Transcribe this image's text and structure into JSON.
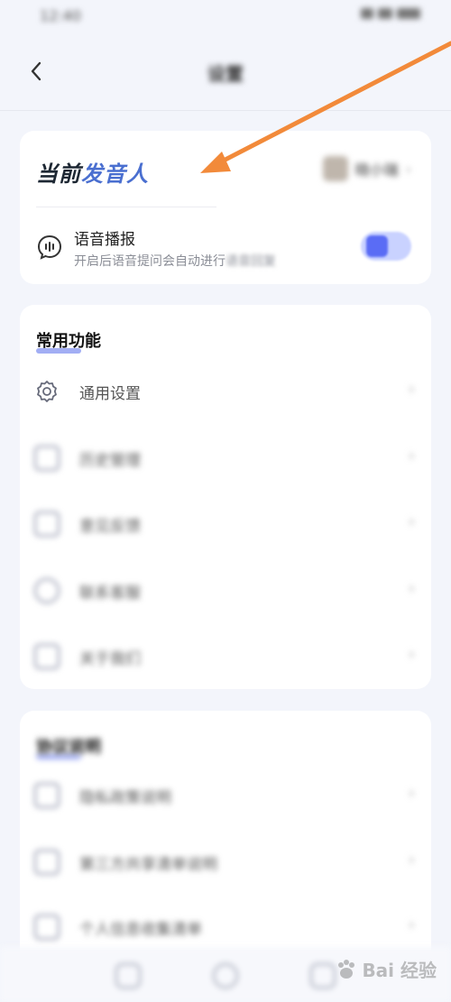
{
  "status_bar": {
    "time": "12:40"
  },
  "nav": {
    "title": "设置"
  },
  "voice_card": {
    "title_part1": "当前",
    "title_part2": "发音人",
    "speaker_name": "晓小瑞",
    "broadcast_title": "语音播报",
    "broadcast_desc": "开启后语音提问会自动进行",
    "broadcast_desc_tail": "语音回复",
    "broadcast_enabled": true
  },
  "common_section": {
    "title": "常用功能",
    "items": [
      {
        "label": "通用设置",
        "icon": "gear-icon"
      },
      {
        "label": "历史管理",
        "icon": "history-icon"
      },
      {
        "label": "意见反馈",
        "icon": "feedback-icon"
      },
      {
        "label": "联系客服",
        "icon": "service-icon"
      },
      {
        "label": "关于我们",
        "icon": "about-icon"
      }
    ]
  },
  "other_section": {
    "title": "协议说明",
    "items": [
      {
        "label": "隐私政策说明",
        "icon": "document-icon"
      },
      {
        "label": "第三方共享清单说明",
        "icon": "document-icon"
      },
      {
        "label": "个人信息收集清单",
        "icon": "document-icon"
      }
    ]
  },
  "watermark": {
    "text": "Bai 经验"
  },
  "colors": {
    "background": "#f3f5fb",
    "card": "#ffffff",
    "accent_blue": "#4a6fd0",
    "toggle_on": "#5a6cf5",
    "arrow": "#f28a3a"
  }
}
